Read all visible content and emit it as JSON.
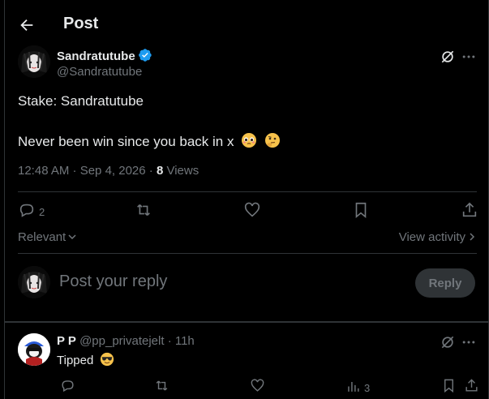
{
  "header": {
    "title": "Post"
  },
  "post": {
    "author_name": "Sandratutube",
    "author_handle": "@Sandratutube",
    "line1": "Stake: Sandratutube",
    "line2": "Never been win since you back in x",
    "timestamp": "12:48 AM · Sep 4, 2026 · ",
    "views_count": "8",
    "views_label": " Views",
    "reply_count": "2"
  },
  "sort": {
    "relevant_label": "Relevant",
    "view_activity_label": "View activity"
  },
  "compose": {
    "placeholder": "Post your reply",
    "reply_button": "Reply"
  },
  "comment": {
    "name": "P P",
    "handle": " @pp_privatejelt · 11h",
    "text": "Tipped",
    "views_count": "3"
  },
  "icons": [
    "back-arrow-icon",
    "verified-badge-icon",
    "grok-icon",
    "more-icon",
    "reply-icon",
    "retweet-icon",
    "like-icon",
    "bookmark-icon",
    "share-icon",
    "chevron-down-icon",
    "chevron-right-icon",
    "views-icon"
  ],
  "colors": {
    "background": "#000000",
    "text": "#e7e9ea",
    "muted": "#71767b",
    "verified": "#1d9bf0",
    "border": "#2f3336"
  }
}
